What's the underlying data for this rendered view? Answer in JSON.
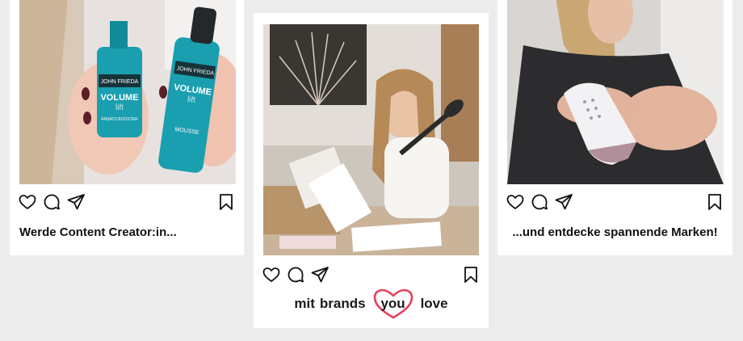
{
  "posts": [
    {
      "caption": "Werde Content Creator:in...",
      "image": "hands-holding-hair-products",
      "product_texts": [
        "JOHN FRIEDA",
        "VOLUME",
        "lift",
        "ANSATZ-BOOSTER",
        "MOUSSE"
      ]
    },
    {
      "caption_parts": [
        "mit",
        "brands",
        "you",
        "love"
      ],
      "image": "woman-unboxing-package"
    },
    {
      "caption": "...und entdecke spannende Marken!",
      "image": "woman-using-ipl-device"
    }
  ],
  "icons": {
    "like": "heart-icon",
    "comment": "comment-icon",
    "share": "send-icon",
    "save": "bookmark-icon"
  },
  "colors": {
    "background": "#ececec",
    "card": "#ffffff",
    "heart_accent": "#e8405b",
    "bottle_teal": "#1a9fb0"
  }
}
